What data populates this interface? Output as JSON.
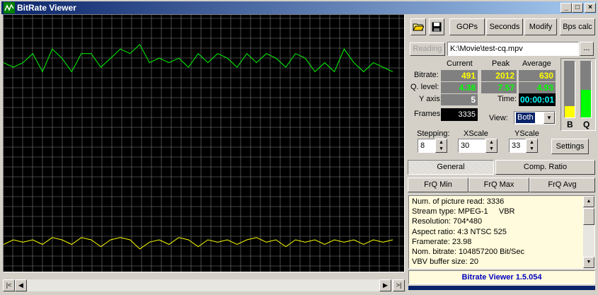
{
  "window": {
    "title": "BitRate Viewer"
  },
  "titlebar_buttons": {
    "minimize": "_",
    "maximize": "□",
    "close": "×"
  },
  "toolbar": {
    "gops": "GOPs",
    "seconds": "Seconds",
    "modify": "Modify",
    "bps_calc": "Bps calc"
  },
  "file": {
    "status": "Reading",
    "path": "K:\\Movie\\test-cq.mpv",
    "browse": "..."
  },
  "stats": {
    "headers": {
      "current": "Current",
      "peak": "Peak",
      "average": "Average"
    },
    "bitrate": {
      "label": "Bitrate:",
      "current": "491",
      "peak": "2012",
      "average": "630"
    },
    "qlevel": {
      "label": "Q. level:",
      "current": "4.38",
      "peak": "7.57",
      "average": "4.93"
    },
    "yaxis": {
      "label": "Y axis:",
      "value": "5"
    },
    "time": {
      "label": "Time:",
      "value": "00:00:01"
    },
    "frames": {
      "label": "Frames:",
      "value": "3335"
    },
    "view": {
      "label": "View:",
      "selected": "Both"
    }
  },
  "meters": {
    "b_label": "B",
    "q_label": "Q",
    "b_level": 0.2,
    "q_level": 0.5,
    "b_color": "#ffff00",
    "q_color": "#00ff00"
  },
  "controls": {
    "stepping": {
      "label": "Stepping:",
      "value": "8"
    },
    "xscale": {
      "label": "XScale",
      "value": "30"
    },
    "yscale": {
      "label": "YScale",
      "value": "33"
    },
    "settings": "Settings"
  },
  "tabs": {
    "general": "General",
    "comp_ratio": "Comp. Ratio"
  },
  "frq": {
    "min": "FrQ Min",
    "max": "FrQ Max",
    "avg": "FrQ Avg"
  },
  "info_lines": [
    "Num. of picture read: 3336",
    "Stream type: MPEG-1     VBR",
    "Resolution: 704*480",
    "Aspect ratio: 4:3 NTSC 525",
    "Framerate: 23.98",
    "Nom. bitrate: 104857200 Bit/Sec",
    "VBV buffer size: 20"
  ],
  "footer": {
    "version": "Bitrate Viewer 1.5.054"
  },
  "chart_data": {
    "type": "line",
    "grid": true,
    "colors": {
      "q_level": "#00ff00",
      "bitrate": "#ffff00",
      "grid": "#808080"
    },
    "series": [
      {
        "values": [
          4.6,
          4.5,
          4.6,
          4.8,
          4.4,
          4.9,
          4.7,
          4.4,
          4.8,
          4.8,
          4.5,
          4.7,
          4.9,
          4.8,
          5.0,
          4.6,
          4.7,
          4.6,
          4.7,
          4.5,
          4.8,
          4.6,
          4.8,
          4.7,
          4.5,
          4.8,
          4.6,
          4.8,
          4.7,
          4.5,
          4.8,
          4.7,
          4.4,
          4.6,
          4.4,
          4.9,
          4.6,
          4.4,
          4.6,
          4.5,
          4.4
        ]
      },
      {
        "values": [
          0.6,
          0.7,
          0.65,
          0.7,
          0.6,
          0.75,
          0.7,
          0.6,
          0.75,
          0.7,
          0.55,
          0.7,
          0.75,
          0.7,
          0.5,
          0.65,
          0.7,
          0.6,
          0.75,
          0.7,
          0.55,
          0.7,
          0.65,
          0.7,
          0.6,
          0.7,
          0.75,
          0.65,
          0.7,
          0.55,
          0.7,
          0.65,
          0.7,
          0.6,
          0.7,
          0.65,
          0.7,
          0.6,
          0.7,
          0.65,
          0.7
        ]
      }
    ]
  }
}
